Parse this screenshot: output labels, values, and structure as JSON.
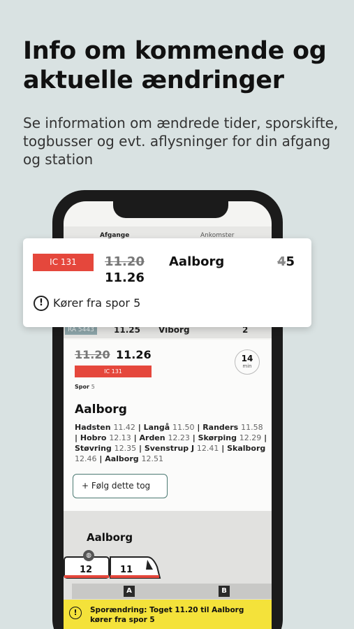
{
  "headline": "Info om kommende og aktuelle ændringer",
  "subline": "Se information om ændrede tider, sporskifte, togbusser og evt. aflysninger for din afgang og station",
  "tabs": {
    "departures": "Afgange",
    "arrivals": "Ankomster"
  },
  "list_row": {
    "train": "RA 5443",
    "time": "11.25",
    "destination": "Viborg",
    "track": "2"
  },
  "popup": {
    "badge": "IC 131",
    "old_time": "11.20",
    "new_time": "11.26",
    "destination": "Aalborg",
    "old_track": "4",
    "new_track": "5",
    "message": "Kører fra spor 5",
    "badge_color": "#e5473c"
  },
  "detail": {
    "old_time": "11.20",
    "new_time": "11.26",
    "badge": "IC 131",
    "spor_label": "Spor",
    "spor_value": "5",
    "minutes": "14",
    "minutes_unit": "min",
    "destination": "Aalborg",
    "stops": [
      {
        "name": "Hadsten",
        "time": "11.42"
      },
      {
        "name": "Langå",
        "time": "11.50"
      },
      {
        "name": "Randers",
        "time": "11.58"
      },
      {
        "name": "Hobro",
        "time": "12.13"
      },
      {
        "name": "Arden",
        "time": "12.23"
      },
      {
        "name": "Skørping",
        "time": "12.29"
      },
      {
        "name": "Støvring",
        "time": "12.35"
      },
      {
        "name": "Svenstrup J",
        "time": "12.41"
      },
      {
        "name": "Skalborg",
        "time": "12.46"
      },
      {
        "name": "Aalborg",
        "time": "12.51"
      }
    ],
    "follow_label": "+ Følg dette tog"
  },
  "train_view": {
    "destination": "Aalborg",
    "wagons": [
      "12",
      "11"
    ],
    "sectors": [
      "A",
      "B"
    ]
  },
  "alert": {
    "text": "Sporændring: Toget 11.20 til Aalborg kører fra spor 5",
    "color": "#f4e23a"
  }
}
